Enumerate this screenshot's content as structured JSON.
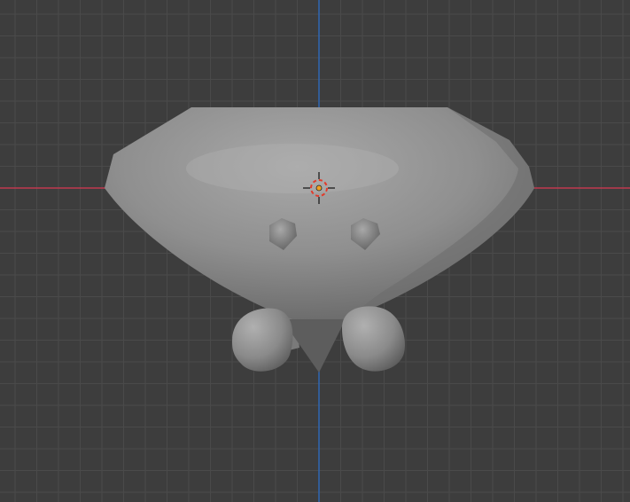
{
  "viewport": {
    "view": "3d-viewport",
    "colors": {
      "background": "#3d3d3d",
      "grid_minor": "#4a4a4a",
      "grid_major": "#525252",
      "x_axis": "#c0394f",
      "z_axis": "#2f66b3",
      "mesh_light": "#a6a6a6",
      "mesh_mid": "#8c8c8c",
      "mesh_dark": "#5e5e5e",
      "cursor_red": "#e23a2a",
      "origin_orange": "#f0a020"
    },
    "objects": [
      {
        "name": "body-mesh",
        "shape": "inverted-rounded-trapezoid"
      },
      {
        "name": "eye-left",
        "shape": "small-bump"
      },
      {
        "name": "eye-right",
        "shape": "small-bump"
      },
      {
        "name": "foot-left",
        "shape": "rounded-blob"
      },
      {
        "name": "foot-right",
        "shape": "rounded-blob"
      }
    ],
    "cursor": {
      "icon": "3d-cursor-icon"
    },
    "origin": {
      "icon": "object-origin-icon"
    }
  }
}
